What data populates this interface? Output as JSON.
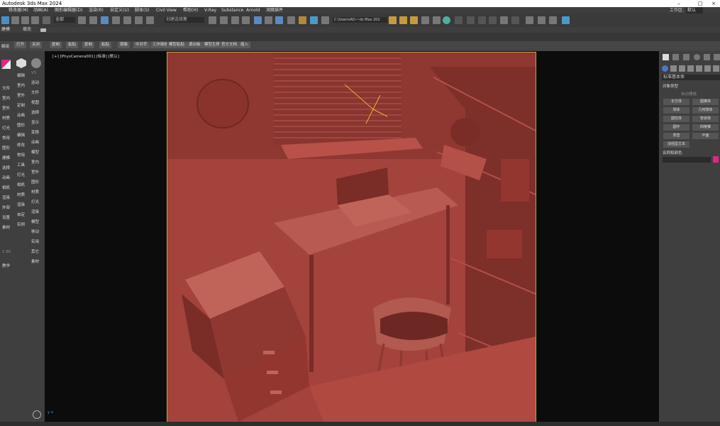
{
  "window": {
    "title": "Autodesk 3ds Max 2024",
    "minimize": "–",
    "maximize": "□",
    "close": "×"
  },
  "menu": [
    "修改器(M)",
    "动画(A)",
    "图形编辑器(D)",
    "渲染(R)",
    "自定义(U)",
    "脚本(S)",
    "Civil View",
    "帮助(H)",
    "V-Ray",
    "Substance",
    "Arnold",
    "洞窝插件"
  ],
  "workspace": {
    "label": "工作区:",
    "value": "默认"
  },
  "toolbar": {
    "selection_filter": "全部",
    "named_selection": "创建选择集",
    "path": "C:\\Users\\AD-~ds Max 202"
  },
  "ribbon": {
    "tab1": "建模",
    "tab2": "填充"
  },
  "quickbar": [
    "解组",
    "打开",
    "关闭",
    "复制",
    "粘贴",
    "复制",
    "粘贴",
    "镜像",
    "中对齐",
    "工作面板",
    "模型粘贴",
    "调出板",
    "模型生移",
    "官方文档",
    "插入"
  ],
  "viewport": {
    "label": "[+] [PhysCamera001] [标准] [默认]"
  },
  "left_sidebar": {
    "col1": [
      "文件",
      "室内",
      "室外",
      "材质",
      "灯光",
      "常用",
      "图形",
      "建模",
      "选择",
      "动画",
      "相机",
      "渲染",
      "外部",
      "设置",
      "素材",
      "教学"
    ],
    "col2": [
      "编辑",
      "室内",
      "室外",
      "定制",
      "动画",
      "图形",
      "编辑",
      "修改",
      "常用",
      "工具",
      "灯光",
      "相机",
      "材质",
      "渲染",
      "自定",
      "实例"
    ],
    "col3": [
      "运动",
      "文件",
      "视图",
      "选择",
      "显示",
      "变换",
      "动画",
      "模型",
      "室内",
      "室外",
      "图形",
      "材质",
      "灯光",
      "渲染",
      "模型",
      "移动",
      "实用",
      "其它",
      "素材"
    ],
    "version": "V3",
    "extra": "2.80"
  },
  "right_panel": {
    "dropdown": "标准基本体",
    "object_type_header": "对象类型",
    "autogrid": "自动栅格",
    "buttons": [
      "长方体",
      "圆锥体",
      "球体",
      "几何球体",
      "圆柱体",
      "管状体",
      "圆环",
      "四棱锥",
      "茶壶",
      "平面",
      "加强型文本"
    ],
    "name_color_header": "名称和颜色",
    "color": "#e0258a"
  }
}
